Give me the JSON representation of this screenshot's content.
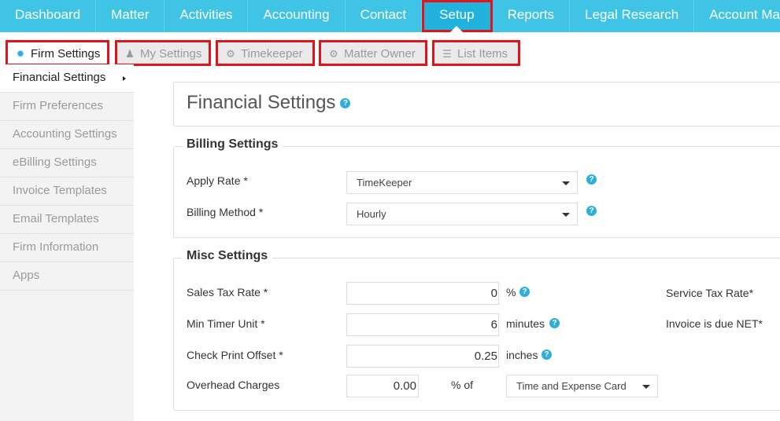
{
  "nav": {
    "tabs": [
      {
        "label": "Dashboard"
      },
      {
        "label": "Matter"
      },
      {
        "label": "Activities"
      },
      {
        "label": "Accounting"
      },
      {
        "label": "Contact"
      },
      {
        "label": "Setup"
      },
      {
        "label": "Reports"
      },
      {
        "label": "Legal Research"
      },
      {
        "label": "Account Manage"
      }
    ],
    "active": "Setup"
  },
  "subtabs": [
    {
      "label": "Firm Settings",
      "icon": "gear-badge-icon"
    },
    {
      "label": "My Settings",
      "icon": "person-icon"
    },
    {
      "label": "Timekeeper",
      "icon": "gears-icon"
    },
    {
      "label": "Matter Owner",
      "icon": "gear-icon"
    },
    {
      "label": "List Items",
      "icon": "list-icon"
    }
  ],
  "sidebar": {
    "items": [
      {
        "label": "Financial Settings"
      },
      {
        "label": "Firm Preferences"
      },
      {
        "label": "Accounting Settings"
      },
      {
        "label": "eBilling Settings"
      },
      {
        "label": "Invoice Templates"
      },
      {
        "label": "Email Templates"
      },
      {
        "label": "Firm Information"
      },
      {
        "label": "Apps"
      }
    ]
  },
  "page": {
    "title": "Financial Settings"
  },
  "billing": {
    "legend": "Billing Settings",
    "apply_rate_label": "Apply Rate *",
    "apply_rate_value": "TimeKeeper",
    "billing_method_label": "Billing Method *",
    "billing_method_value": "Hourly"
  },
  "misc": {
    "legend": "Misc Settings",
    "sales_tax_label": "Sales Tax Rate *",
    "sales_tax_value": "0",
    "sales_tax_unit": "%",
    "min_timer_label": "Min Timer Unit *",
    "min_timer_value": "6",
    "min_timer_unit": "minutes",
    "check_offset_label": "Check Print Offset *",
    "check_offset_value": "0.25",
    "check_offset_unit": "inches",
    "overhead_label": "Overhead Charges",
    "overhead_value": "0.00",
    "overhead_unit": "% of",
    "overhead_basis": "Time and Expense Card",
    "service_tax_label": "Service Tax Rate*",
    "invoice_due_label": "Invoice is due NET*"
  },
  "colors": {
    "nav_bg": "#3fc4e6",
    "nav_active": "#22b3dc",
    "highlight": "#e0141b",
    "help": "#2eaedc"
  }
}
